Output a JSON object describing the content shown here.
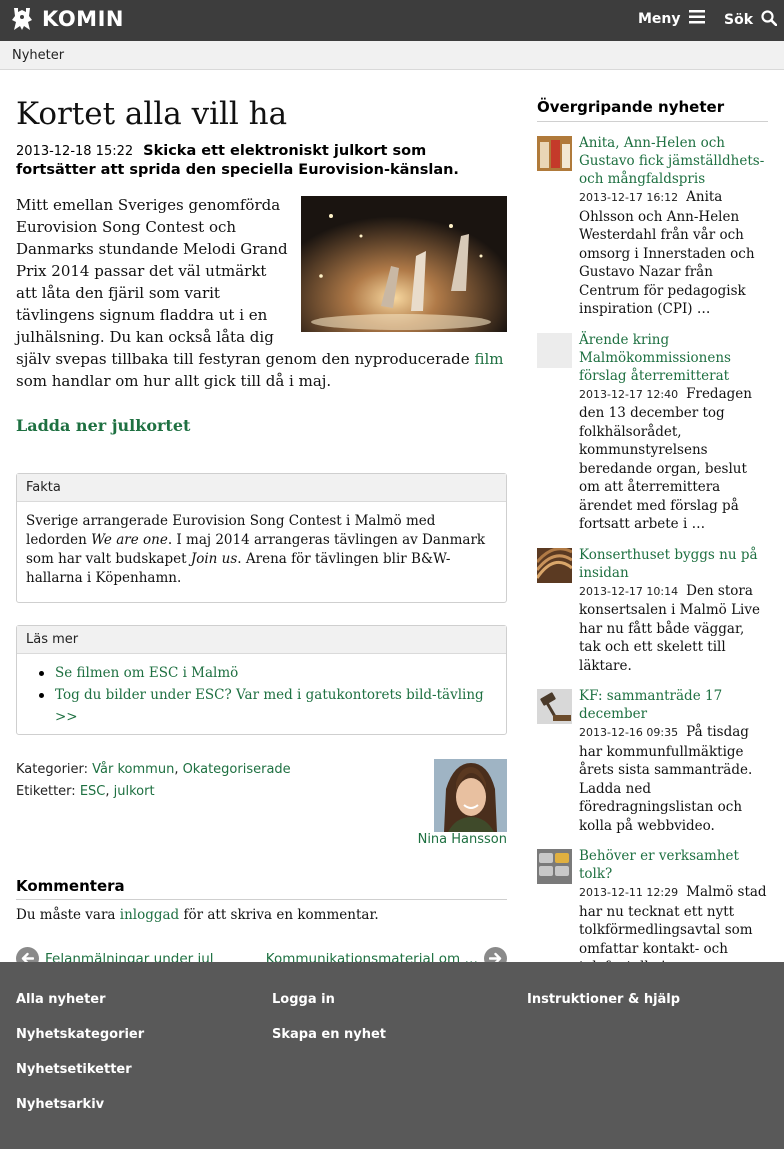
{
  "header": {
    "logo_text": "KOMIN",
    "menu_label": "Meny",
    "search_label": "Sök"
  },
  "breadcrumb": "Nyheter",
  "article": {
    "title": "Kortet alla vill ha",
    "date": "2013-12-18 15:22",
    "lead": "Skicka ett elektroniskt julkort som fortsätter att sprida den speciella Eurovision-känslan.",
    "body_part1": "Mitt emellan Sveriges genomförda Eurovision Song Contest och Danmarks stundande Melodi Grand Prix 2014 passar det väl utmärkt att låta den fjäril som varit tävlingens signum fladdra ut i en julhälsning. Du kan också låta dig själv svepas tillbaka till festyran genom den nyproducerade ",
    "body_link": "film",
    "body_part2": " som handlar om hur allt gick till då i maj.",
    "download_link": "Ladda ner julkortet"
  },
  "fakta": {
    "heading": "Fakta",
    "text_a": "Sverige arrangerade Eurovision Song Contest i Malmö med ledorden ",
    "text_em1": "We are one",
    "text_b": ". I maj 2014 arrangeras tävlingen av Danmark som har valt budskapet ",
    "text_em2": "Join us",
    "text_c": ". Arena för tävlingen blir B&W-hallarna i Köpenhamn."
  },
  "las_mer": {
    "heading": "Läs mer",
    "links": [
      "Se filmen om ESC i Malmö",
      "Tog du bilder under ESC? Var med i gatukontorets bild-tävling >>"
    ]
  },
  "meta": {
    "categories_label": "Kategorier:",
    "categories": [
      "Vår kommun",
      "Okategoriserade"
    ],
    "tags_label": "Etiketter:",
    "tags": [
      "ESC",
      "julkort"
    ],
    "author": "Nina Hansson"
  },
  "comments": {
    "heading": "Kommentera",
    "text_a": "Du måste vara ",
    "link": "inloggad",
    "text_b": " för att skriva en kommentar."
  },
  "pager": {
    "prev": "Felanmälningar under jul",
    "next": "Kommunikationsmaterial om …"
  },
  "sidebar": {
    "title": "Övergripande nyheter",
    "items": [
      {
        "title": "Anita, Ann-Helen och Gustavo fick jämställdhets- och mångfaldspris",
        "date": "2013-12-17 16:12",
        "text": "Anita Ohlsson och Ann-Helen Westerdahl från vår och omsorg i Innerstaden och Gustavo Nazar från Centrum för pedagogisk inspiration (CPI) …"
      },
      {
        "title": "Ärende kring Malmökommissionens förslag återremitterat",
        "date": "2013-12-17 12:40",
        "text": "Fredagen den 13 december tog folkhälsorådet, kommunstyrelsens beredande organ, beslut om att återremittera ärendet med förslag på fortsatt arbete i …"
      },
      {
        "title": "Konserthuset byggs nu på insidan",
        "date": "2013-12-17 10:14",
        "text": "Den stora konsertsalen i Malmö Live har nu fått både väggar, tak och ett skelett till läktare."
      },
      {
        "title": "KF: sammanträde 17 december",
        "date": "2013-12-16 09:35",
        "text": "På tisdag har kommunfullmäktige årets sista sammanträde. Ladda ned föredragningslistan och kolla på webbvideo."
      },
      {
        "title": "Behöver er verksamhet tolk?",
        "date": "2013-12-11 12:29",
        "text": "Malmö stad har nu tecknat ett nytt tolkförmedlingsavtal som omfattar kontakt- och telefontolkning."
      }
    ]
  },
  "footer": {
    "col1": [
      "Alla nyheter",
      "Nyhetskategorier",
      "Nyhetsetiketter",
      "Nyhetsarkiv"
    ],
    "col2": [
      "Logga in",
      "Skapa en nyhet"
    ],
    "col3": [
      "Instruktioner & hjälp"
    ]
  }
}
